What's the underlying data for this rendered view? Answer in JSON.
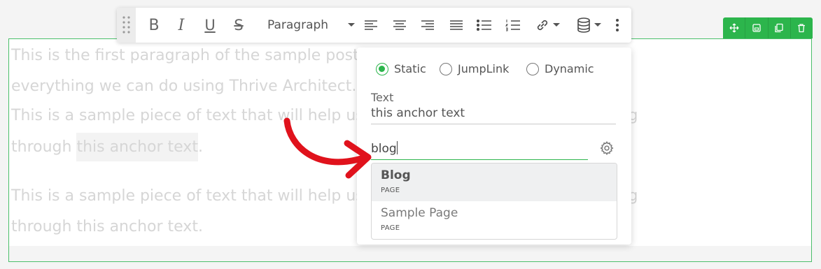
{
  "content": {
    "paragraphs": [
      "This is the first paragraph of the sample post, I hope you will take a look at",
      "everything we can do using Thrive Architect.",
      "This is a sample piece of text that will help us get started. Let us begin by linking",
      "through ",
      "this anchor text",
      ".",
      "This is a sample piece of text that will help us get started. Let us begin by linking",
      "through this anchor text."
    ]
  },
  "toolbar": {
    "bold": "B",
    "italic": "I",
    "underline": "U",
    "strikethrough": "S",
    "paragraph_select": "Paragraph"
  },
  "link_popup": {
    "link_types": [
      {
        "label": "Static",
        "selected": true
      },
      {
        "label": "JumpLink",
        "selected": false
      },
      {
        "label": "Dynamic",
        "selected": false
      }
    ],
    "text_label": "Text",
    "text_value": "this anchor text",
    "search_value": "blog",
    "suggestions": [
      {
        "title": "Blog",
        "type": "PAGE",
        "highlighted": true
      },
      {
        "title": "Sample Page",
        "type": "PAGE",
        "highlighted": false
      }
    ]
  },
  "colors": {
    "accent": "#2cb54c",
    "arrow": "#e0121c"
  }
}
